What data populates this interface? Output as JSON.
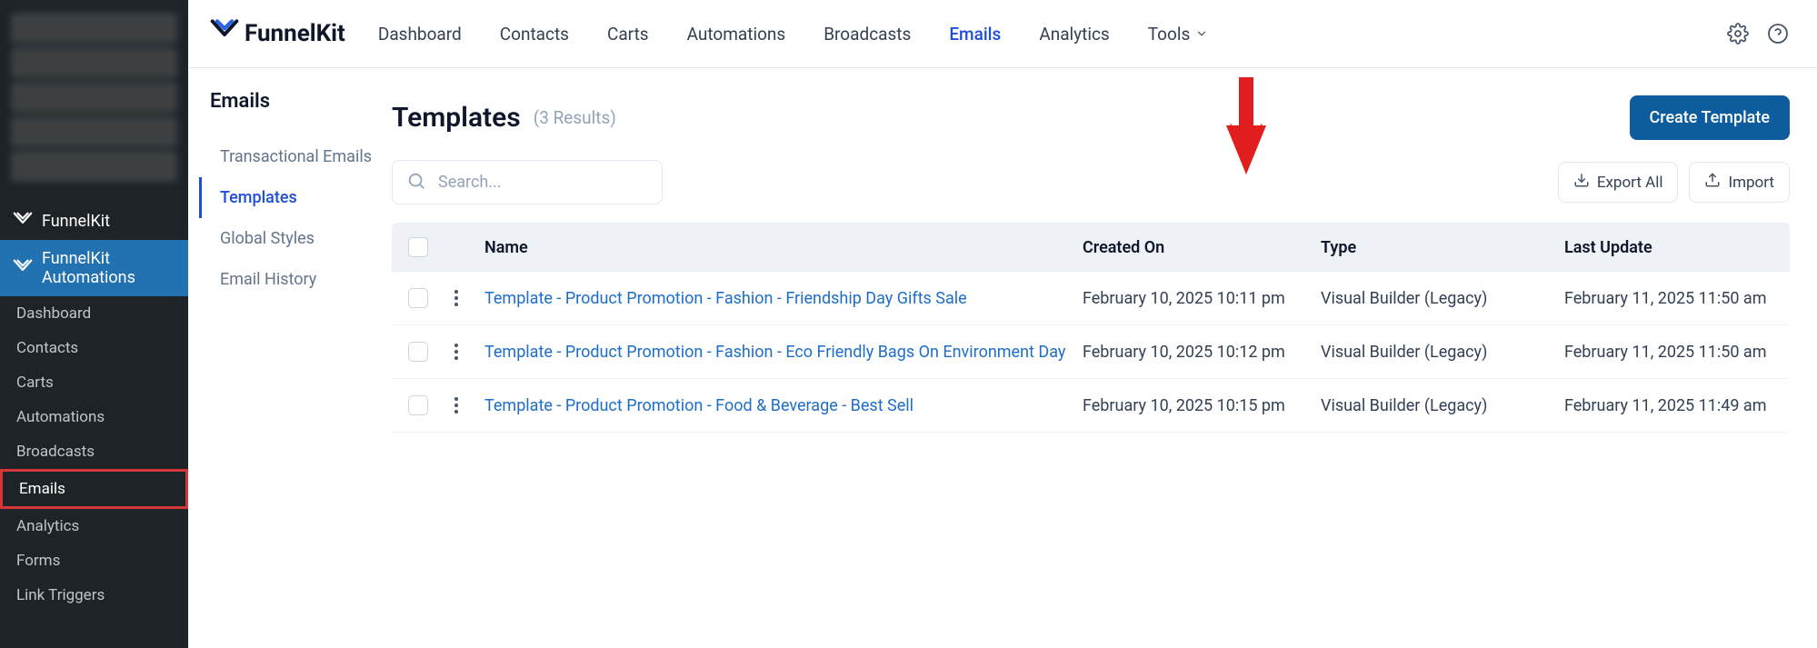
{
  "wp_sidebar": {
    "main1": "FunnelKit",
    "main2": "FunnelKit Automations",
    "subs": [
      "Dashboard",
      "Contacts",
      "Carts",
      "Automations",
      "Broadcasts",
      "Emails",
      "Analytics",
      "Forms",
      "Link Triggers"
    ]
  },
  "top_nav": {
    "brand": "FunnelKit",
    "items": [
      "Dashboard",
      "Contacts",
      "Carts",
      "Automations",
      "Broadcasts",
      "Emails",
      "Analytics",
      "Tools"
    ]
  },
  "side_nav": {
    "title": "Emails",
    "items": [
      "Transactional Emails",
      "Templates",
      "Global Styles",
      "Email History"
    ]
  },
  "content": {
    "title": "Templates",
    "result_count": "(3 Results)",
    "create_btn": "Create Template",
    "export_btn": "Export All",
    "import_btn": "Import",
    "search_placeholder": "Search..."
  },
  "table": {
    "headers": {
      "name": "Name",
      "created": "Created On",
      "type": "Type",
      "updated": "Last Update"
    },
    "rows": [
      {
        "name": "Template - Product Promotion - Fashion - Friendship Day Gifts Sale",
        "created": "February 10, 2025 10:11 pm",
        "type": "Visual Builder (Legacy)",
        "updated": "February 11, 2025 11:50 am"
      },
      {
        "name": "Template - Product Promotion - Fashion - Eco Friendly Bags On Environment Day",
        "created": "February 10, 2025 10:12 pm",
        "type": "Visual Builder (Legacy)",
        "updated": "February 11, 2025 11:50 am"
      },
      {
        "name": "Template - Product Promotion - Food & Beverage - Best Sell",
        "created": "February 10, 2025 10:15 pm",
        "type": "Visual Builder (Legacy)",
        "updated": "February 11, 2025 11:49 am"
      }
    ]
  }
}
